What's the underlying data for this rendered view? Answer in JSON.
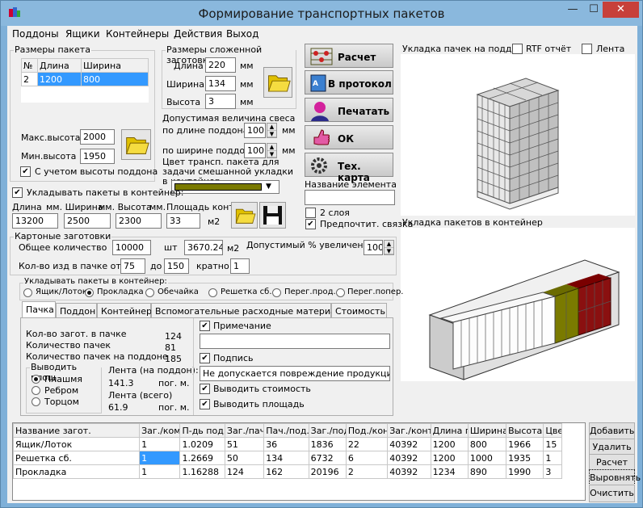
{
  "window": {
    "title": "Формирование транспортных пакетов",
    "min": "—",
    "max": "☐",
    "close": "✕"
  },
  "menu": [
    "Поддоны",
    "Ящики",
    "Контейнеры",
    "Действия",
    "Выход"
  ],
  "pack_sizes": {
    "legend": "Размеры пакета",
    "headers": [
      "№",
      "Длина",
      "Ширина"
    ],
    "row": [
      "2",
      "1200",
      "800"
    ],
    "max_height_label": "Макс.высота",
    "max_height": "2000",
    "min_height_label": "Мин.высота",
    "min_height": "1950",
    "pallet_height_label": "С учетом высоты поддона",
    "pallet_height_checked": true
  },
  "blank_sizes": {
    "legend": "Размеры сложенной заготовки",
    "length_label": "Длина",
    "length": "220",
    "width_label": "Ширина",
    "width": "134",
    "height_label": "Высота",
    "height": "3",
    "unit": "мм"
  },
  "overhang": {
    "title": "Допустимая величина свеса",
    "by_length_label": "по длине поддона",
    "by_length": "100",
    "by_width_label": "по ширине поддона",
    "by_width": "100",
    "unit": "мм"
  },
  "color_label": "Цвет трансп. пакета для задачи смешанной укладки в контейнер",
  "color_value": "#7a7a00",
  "buttons": {
    "calc": "Расчет",
    "protocol": "В протокол",
    "print": "Печатать",
    "ok": "ОК",
    "tech": "Тех. карта"
  },
  "element_name_label": "Название элемента",
  "element_name": "",
  "two_layers_label": "2 слоя",
  "two_layers": false,
  "prefer_label": "Предпочтит. связка",
  "prefer": true,
  "pallet_view": {
    "label": "Укладка пачек на поддон",
    "rtf_label": "RTF отчёт",
    "tape_label": "Лента"
  },
  "container_view": {
    "label": "Укладка пакетов в контейнер"
  },
  "container": {
    "pack_in_label": "Укладывать пакеты в контейнер:",
    "pack_in": true,
    "headers": [
      "Длина",
      "мм. Ширина",
      "мм. Высота",
      "мм.",
      "Площадь конт."
    ],
    "length": "13200",
    "width": "2500",
    "height": "2300",
    "area": "33",
    "area_unit": "м2"
  },
  "cartons": {
    "legend": "Картоные заготовки",
    "total_label": "Общее количество",
    "total": "10000",
    "unit_pcs": "шт",
    "area": "3670.24",
    "area_unit": "м2",
    "increase_label": "Допустимый % увеличения",
    "increase": "100",
    "per_pack_label": "Кол-во изд в пачке от",
    "from": "75",
    "to_label": "до",
    "to": "150",
    "mult_label": "кратно",
    "mult": "1"
  },
  "stack": {
    "legend": "Укладывать пакеты в контейнер:",
    "options": [
      "Ящик/Лоток",
      "Прокладка",
      "Обечайка",
      "Решетка сб.",
      "Перег.прод.",
      "Перег.попер."
    ],
    "selected": 1
  },
  "tabs": [
    "Пачка",
    "Поддон",
    "Контейнер",
    "Вспомогательные расходные материалы",
    "Стоимость"
  ],
  "tab_pack": {
    "rows": [
      {
        "label": "Кол-во загот. в пачке",
        "value": "124"
      },
      {
        "label": "Количество пачек",
        "value": "81"
      },
      {
        "label": "Количество пачек на поддоне",
        "value": "185"
      }
    ],
    "output_legend": "Выводить площ",
    "output_options": [
      "Плашмя",
      "Ребром",
      "Торцом"
    ],
    "output_selected": 0,
    "tape_pallet_label": "Лента (на поддон):",
    "tape_pallet": "141.3",
    "tape_total_label": "Лента (всего)",
    "tape_total": "61.9",
    "unit": "пог. м.",
    "note_label": "Примечание",
    "note": "",
    "sign_label": "Подпись",
    "sign": "Не допускается повреждение продукции обтя",
    "show_cost_label": "Выводить стоимость",
    "show_area_label": "Выводить площадь"
  },
  "grid": {
    "headers": [
      "Название загот.",
      "Заг./ком",
      "П-дь под.",
      "Заг./пач",
      "Пач./под.",
      "Заг./под",
      "Под./кон",
      "Заг./конт",
      "Длина п",
      "Ширина",
      "Высота",
      "Цве"
    ],
    "rows": [
      [
        "Ящик/Лоток",
        "1",
        "1.0209",
        "51",
        "36",
        "1836",
        "22",
        "40392",
        "1200",
        "800",
        "1966",
        "15"
      ],
      [
        "Решетка сб.",
        "1",
        "1.2669",
        "50",
        "134",
        "6732",
        "6",
        "40392",
        "1200",
        "1000",
        "1935",
        "1"
      ],
      [
        "Прокладка",
        "1",
        "1.16288",
        "124",
        "162",
        "20196",
        "2",
        "40392",
        "1234",
        "890",
        "1990",
        "3"
      ]
    ],
    "selected_cell": [
      1,
      1
    ]
  },
  "side_buttons": [
    "Добавить",
    "Удалить",
    "Расчет",
    "Выровнять",
    "Очистить"
  ]
}
